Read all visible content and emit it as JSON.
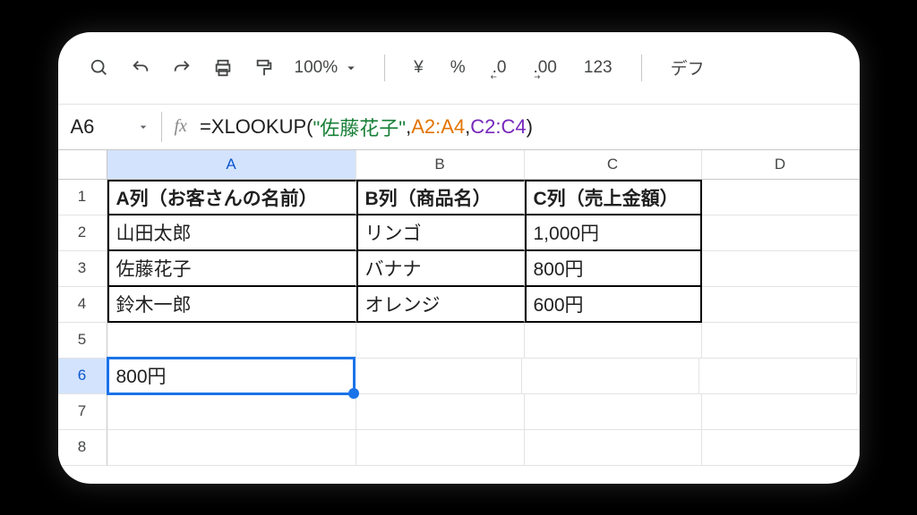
{
  "toolbar": {
    "zoom": "100%",
    "currency": "¥",
    "percent": "%",
    "dec_dec": ".0",
    "inc_dec": ".00",
    "num_fmt": "123",
    "font_label": "デフ"
  },
  "namebox": "A6",
  "formula": {
    "prefix": "=XLOOKUP(",
    "arg1": "\"佐藤花子\"",
    "sep1": ", ",
    "arg2": "A2:A4",
    "sep2": ", ",
    "arg3": "C2:C4",
    "suffix": ")"
  },
  "columns": [
    "A",
    "B",
    "C",
    "D"
  ],
  "rows": [
    "1",
    "2",
    "3",
    "4",
    "5",
    "6",
    "7",
    "8"
  ],
  "selected_row": "6",
  "selected_col": "A",
  "data": {
    "r1": {
      "A": "A列（お客さんの名前）",
      "B": "B列（商品名）",
      "C": "C列（売上金額）",
      "D": ""
    },
    "r2": {
      "A": "山田太郎",
      "B": "リンゴ",
      "C": "1,000円",
      "D": ""
    },
    "r3": {
      "A": "佐藤花子",
      "B": "バナナ",
      "C": "800円",
      "D": ""
    },
    "r4": {
      "A": "鈴木一郎",
      "B": "オレンジ",
      "C": "600円",
      "D": ""
    },
    "r5": {
      "A": "",
      "B": "",
      "C": "",
      "D": ""
    },
    "r6": {
      "A": "800円",
      "B": "",
      "C": "",
      "D": ""
    },
    "r7": {
      "A": "",
      "B": "",
      "C": "",
      "D": ""
    },
    "r8": {
      "A": "",
      "B": "",
      "C": "",
      "D": ""
    }
  }
}
